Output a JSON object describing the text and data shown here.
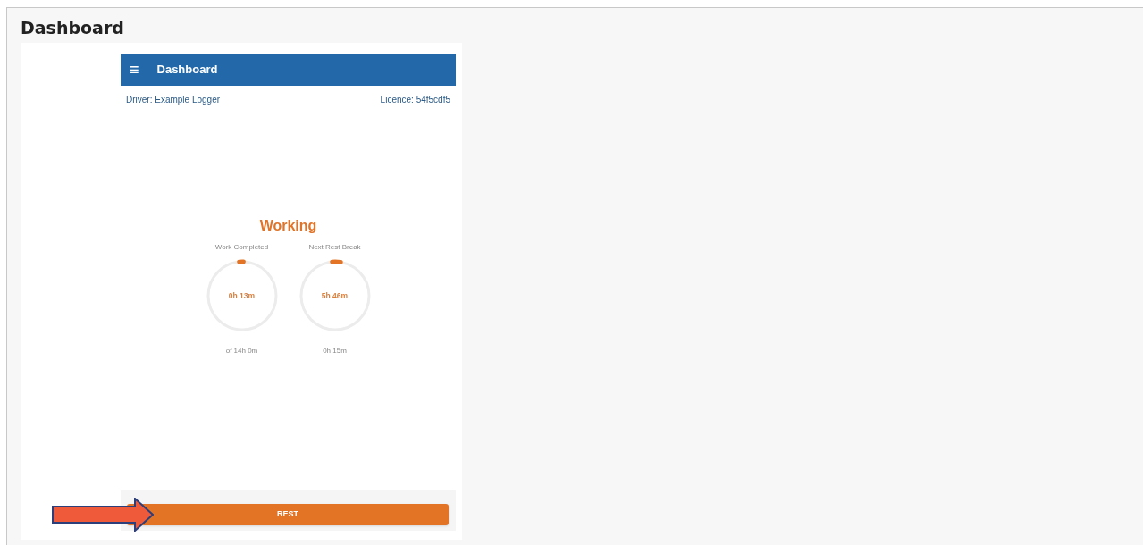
{
  "page": {
    "title": "Dashboard"
  },
  "app_bar": {
    "menu_icon": "≡",
    "title": "Dashboard"
  },
  "info": {
    "driver": "Driver: Example Logger",
    "licence": "Licence: 54f5cdf5"
  },
  "status": "Working",
  "gauges": [
    {
      "label": "Work Completed",
      "value": "0h 13m",
      "caption": "of 14h 0m",
      "level": 0.02
    },
    {
      "label": "Next Rest Break",
      "value": "5h 46m",
      "caption": "0h 15m",
      "level": 0.04
    }
  ],
  "button": {
    "label": "REST"
  }
}
